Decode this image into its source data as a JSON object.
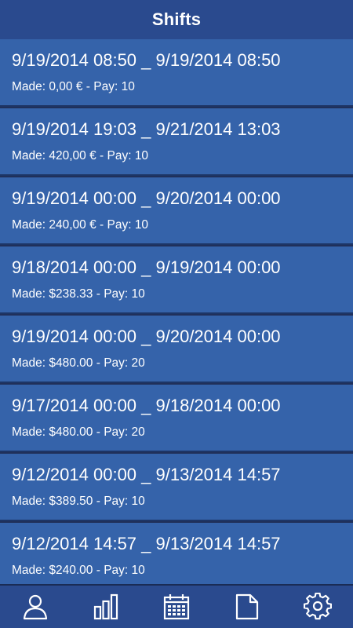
{
  "header": {
    "title": "Shifts"
  },
  "shifts": [
    {
      "range": "9/19/2014 08:50 _ 9/19/2014 08:50",
      "summary": "Made: 0,00 € - Pay: 10"
    },
    {
      "range": "9/19/2014 19:03 _ 9/21/2014 13:03",
      "summary": "Made: 420,00 € - Pay: 10"
    },
    {
      "range": "9/19/2014 00:00 _ 9/20/2014 00:00",
      "summary": "Made: 240,00 € - Pay: 10"
    },
    {
      "range": "9/18/2014 00:00 _ 9/19/2014 00:00",
      "summary": "Made: $238.33 - Pay: 10"
    },
    {
      "range": "9/19/2014 00:00 _ 9/20/2014 00:00",
      "summary": "Made: $480.00 - Pay: 20"
    },
    {
      "range": "9/17/2014 00:00 _ 9/18/2014 00:00",
      "summary": "Made: $480.00 - Pay: 20"
    },
    {
      "range": "9/12/2014 00:00 _ 9/13/2014 14:57",
      "summary": "Made: $389.50 - Pay: 10"
    },
    {
      "range": "9/12/2014 14:57 _ 9/13/2014 14:57",
      "summary": "Made: $240.00 - Pay: 10"
    }
  ],
  "tabs": [
    {
      "icon": "person-icon"
    },
    {
      "icon": "bar-chart-icon"
    },
    {
      "icon": "calendar-icon"
    },
    {
      "icon": "document-icon"
    },
    {
      "icon": "gear-icon"
    }
  ],
  "colors": {
    "bar": "#2a4a8e",
    "row": "#3563aa",
    "divider": "#1d3566",
    "text": "#ffffff"
  }
}
